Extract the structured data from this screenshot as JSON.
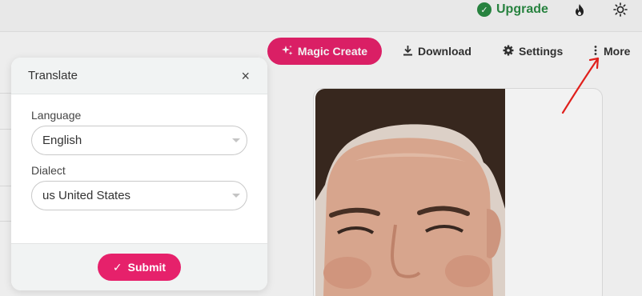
{
  "topbar": {
    "upgrade_label": "Upgrade",
    "upgrade_icon": "verified-check-icon",
    "fire_icon": "fire-icon",
    "theme_icon": "sun-icon"
  },
  "toolbar": {
    "magic_create_label": "Magic Create",
    "download_label": "Download",
    "settings_label": "Settings",
    "more_label": "More"
  },
  "modal": {
    "title": "Translate",
    "close_symbol": "×",
    "language_label": "Language",
    "language_value": "English",
    "dialect_label": "Dialect",
    "dialect_value": "us United States",
    "submit_label": "Submit",
    "submit_check": "✓"
  },
  "colors": {
    "accent": "#e6216b",
    "upgrade_green": "#2a8a43",
    "annotation_arrow": "#e0201c"
  }
}
